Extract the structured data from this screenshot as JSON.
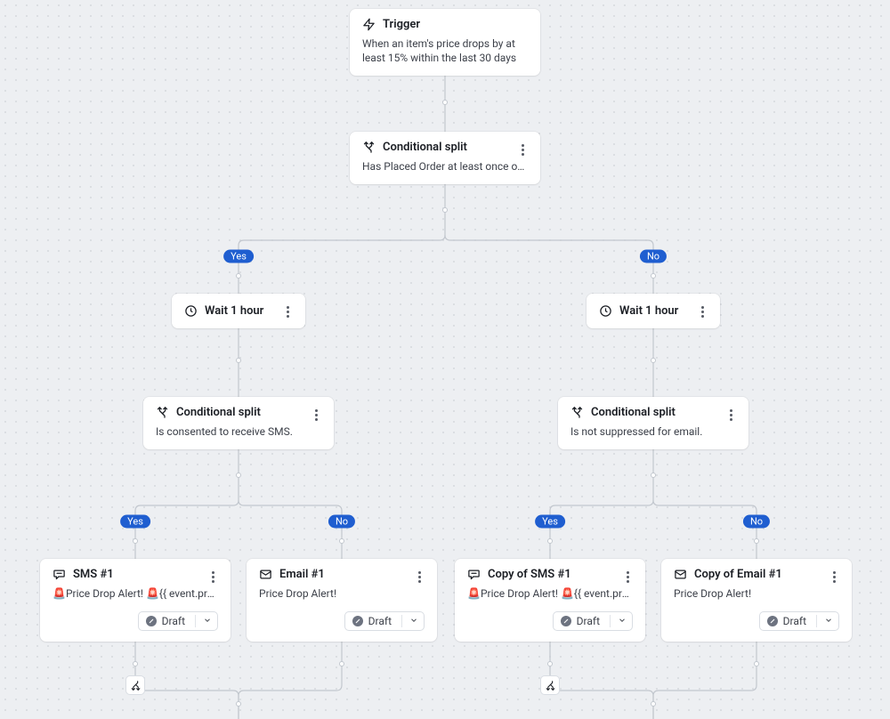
{
  "trigger": {
    "title": "Trigger",
    "desc": "When an item's price drops by at least 15% within the last 30 days"
  },
  "split_top": {
    "title": "Conditional split",
    "desc": "Has Placed Order at least once over all ti…"
  },
  "branches": {
    "yes": "Yes",
    "no": "No"
  },
  "wait_left": {
    "title": "Wait 1 hour"
  },
  "wait_right": {
    "title": "Wait 1 hour"
  },
  "split_left": {
    "title": "Conditional split",
    "desc": "Is consented to receive SMS."
  },
  "split_right": {
    "title": "Conditional split",
    "desc": "Is not suppressed for email."
  },
  "sms1": {
    "title": "SMS #1",
    "desc": "🚨Price Drop Alert! 🚨{{ event.product_n…",
    "status": "Draft"
  },
  "email1": {
    "title": "Email #1",
    "desc": "Price Drop Alert!",
    "status": "Draft"
  },
  "sms2": {
    "title": "Copy of SMS #1",
    "desc": "🚨Price Drop Alert! 🚨{{ event.product_n…",
    "status": "Draft"
  },
  "email2": {
    "title": "Copy of Email #1",
    "desc": "Price Drop Alert!",
    "status": "Draft"
  }
}
